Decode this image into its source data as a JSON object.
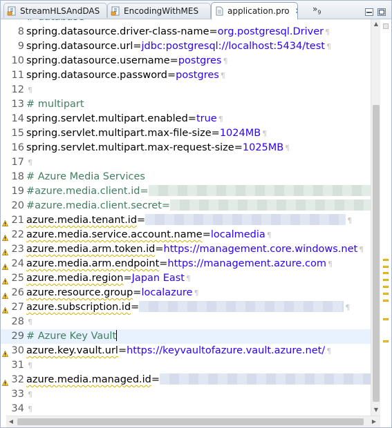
{
  "tabs": [
    {
      "label": "StreamHLSAndDAS",
      "icon": "java-file-icon"
    },
    {
      "label": "EncodingWithMES",
      "icon": "java-file-icon"
    },
    {
      "label": "application.pro",
      "icon": "properties-file-icon"
    }
  ],
  "tab_overflow": {
    "symbol": "»",
    "count": "9"
  },
  "partial_top_line": "# database",
  "lines": [
    {
      "n": "8",
      "key": "spring.datasource.driver-class-name",
      "val": "org.postgresql.Driver"
    },
    {
      "n": "9",
      "key": "spring.datasource.url",
      "val": "jdbc:postgresql://localhost:5434/test"
    },
    {
      "n": "10",
      "key": "spring.datasource.username",
      "val": "postgres"
    },
    {
      "n": "11",
      "key": "spring.datasource.password",
      "val": "postgres"
    },
    {
      "n": "12"
    },
    {
      "n": "13",
      "comment": "# multipart"
    },
    {
      "n": "14",
      "key": "spring.servlet.multipart.enabled",
      "val": "true"
    },
    {
      "n": "15",
      "key": "spring.servlet.multipart.max-file-size",
      "val": "1024MB"
    },
    {
      "n": "16",
      "key": "spring.servlet.multipart.max-request-size",
      "val": "1025MB"
    },
    {
      "n": "17"
    },
    {
      "n": "18",
      "comment": "# Azure Media Services"
    },
    {
      "n": "19",
      "comment": "#azure.media.client.id="
    },
    {
      "n": "20",
      "comment": "#azure.media.client.secret="
    },
    {
      "n": "21",
      "key": "azure.media.tenant.id",
      "warn": true
    },
    {
      "n": "22",
      "key": "azure.media.service.account.name",
      "val": "localmedia",
      "warn": true
    },
    {
      "n": "23",
      "key": "azure.media.arm.token.id",
      "val": "https://management.core.windows.net",
      "warn": true
    },
    {
      "n": "24",
      "key": "azure.media.arm.endpoint",
      "val": "https://management.azure.com",
      "warn": true
    },
    {
      "n": "25",
      "key": "azure.media.region",
      "val": "Japan East",
      "warn": true
    },
    {
      "n": "26",
      "key": "azure.resource.group",
      "val": "localazure",
      "warn": true
    },
    {
      "n": "27",
      "key": "azure.subscription.id",
      "warn": true
    },
    {
      "n": "28"
    },
    {
      "n": "29",
      "comment": "# Azure Key Vault",
      "current": true
    },
    {
      "n": "30",
      "key": "azure.key.vault.url",
      "val": "https://keyvaultofazure.vault.azure.net/",
      "warn": true
    },
    {
      "n": "31"
    },
    {
      "n": "32",
      "key": "azure.media.managed.id",
      "warn": true
    },
    {
      "n": "33"
    },
    {
      "n": "34"
    }
  ],
  "colors": {
    "key": "#000000",
    "value": "#2a00ff",
    "comment": "#3f7f5f",
    "line_number": "#5f5f5f",
    "current_line": "#e8f2fe",
    "warning": "#f3cf3a"
  }
}
